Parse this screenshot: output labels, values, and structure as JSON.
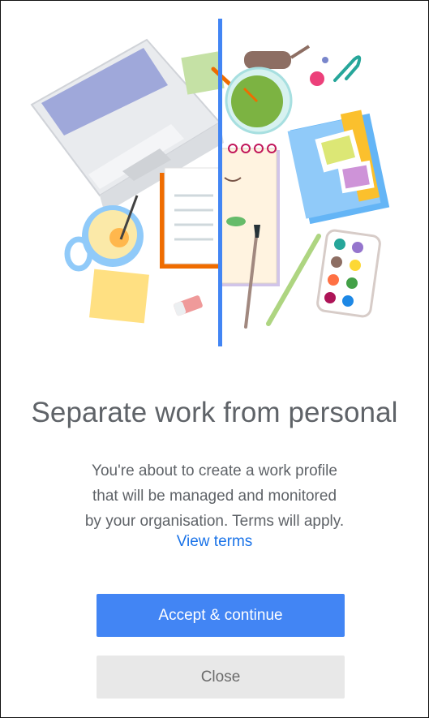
{
  "page": {
    "title": "Separate work from personal",
    "description_lines": [
      "You're about to create a work profile",
      "that will be managed and monitored",
      "by your organisation. Terms will apply."
    ],
    "view_terms_label": "View terms"
  },
  "actions": {
    "accept_label": "Accept & continue",
    "close_label": "Close"
  },
  "colors": {
    "accent": "#4285f4",
    "link": "#1a73e8",
    "text": "#5f6368",
    "secondary_button": "#e8e8e8"
  }
}
